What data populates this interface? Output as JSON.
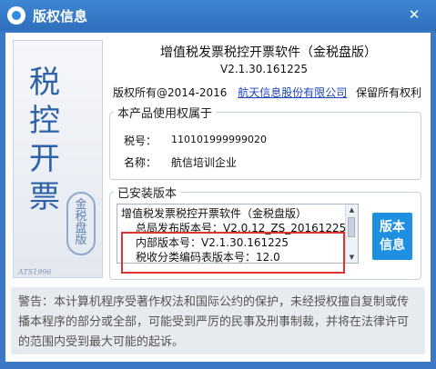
{
  "window": {
    "title": "版权信息",
    "close_glyph": "✕"
  },
  "banner": {
    "title": "税控开票",
    "subtitle": "金税盘版",
    "logo": "ATS1996"
  },
  "product": {
    "name": "增值税发票税控开票软件（金税盘版）",
    "version": "V2.1.30.161225",
    "copyright_prefix": "版权所有@2014-2016",
    "company": "航天信息股份有限公司",
    "rights": "保留所有权利"
  },
  "owner": {
    "legend": "本产品使用权属于",
    "tax_label": "税号：",
    "tax_value": "110101999999020",
    "name_label": "名称：",
    "name_value": "航信培训企业"
  },
  "installed": {
    "legend": "已安装版本",
    "lines": [
      "增值税发票税控开票软件（金税盘版）",
      "总局发布版本号：V2.0.12_ZS_20161225",
      "内部版本号：V2.1.30.161225",
      "税收分类编码表版本号：12.0"
    ],
    "button_line1": "版本",
    "button_line2": "信息"
  },
  "warning": {
    "lines": [
      "警告：本计算机程序受著作权法和国际公约的保护，未经授权擅自复制或传",
      "播本程序的部分或全部，可能受到严厉的民事及刑事制裁，并将在法律许可",
      "的范围内受到最大可能的起诉。"
    ]
  },
  "colors": {
    "titlebar": "#2f6fbd",
    "button": "#1f8fe0",
    "highlight": "#e0322e",
    "link": "#1d45b8"
  }
}
